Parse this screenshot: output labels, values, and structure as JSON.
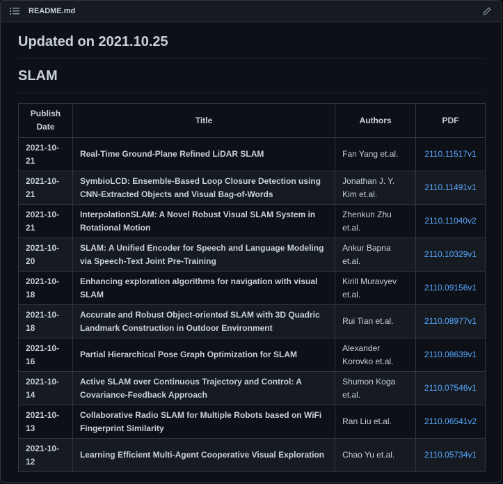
{
  "header": {
    "file_name": "README.md",
    "list_icon": "list-unordered-icon",
    "edit_icon": "pencil-icon"
  },
  "updated_heading": "Updated on 2021.10.25",
  "section_heading": "SLAM",
  "table": {
    "columns": [
      "Publish Date",
      "Title",
      "Authors",
      "PDF"
    ],
    "rows": [
      {
        "date": "2021-10-21",
        "title": "Real-Time Ground-Plane Refined LiDAR SLAM",
        "authors": "Fan Yang et.al.",
        "pdf": "2110.11517v1"
      },
      {
        "date": "2021-10-21",
        "title": "SymbioLCD: Ensemble-Based Loop Closure Detection using CNN-Extracted Objects and Visual Bag-of-Words",
        "authors": "Jonathan J. Y. Kim et.al.",
        "pdf": "2110.11491v1"
      },
      {
        "date": "2021-10-21",
        "title": "InterpolationSLAM: A Novel Robust Visual SLAM System in Rotational Motion",
        "authors": "Zhenkun Zhu et.al.",
        "pdf": "2110.11040v2"
      },
      {
        "date": "2021-10-20",
        "title": "SLAM: A Unified Encoder for Speech and Language Modeling via Speech-Text Joint Pre-Training",
        "authors": "Ankur Bapna et.al.",
        "pdf": "2110.10329v1"
      },
      {
        "date": "2021-10-18",
        "title": "Enhancing exploration algorithms for navigation with visual SLAM",
        "authors": "Kirill Muravyev et.al.",
        "pdf": "2110.09156v1"
      },
      {
        "date": "2021-10-18",
        "title": "Accurate and Robust Object-oriented SLAM with 3D Quadric Landmark Construction in Outdoor Environment",
        "authors": "Rui Tian et.al.",
        "pdf": "2110.08977v1"
      },
      {
        "date": "2021-10-16",
        "title": "Partial Hierarchical Pose Graph Optimization for SLAM",
        "authors": "Alexander Korovko et.al.",
        "pdf": "2110.08639v1"
      },
      {
        "date": "2021-10-14",
        "title": "Active SLAM over Continuous Trajectory and Control: A Covariance-Feedback Approach",
        "authors": "Shumon Koga et.al.",
        "pdf": "2110.07546v1"
      },
      {
        "date": "2021-10-13",
        "title": "Collaborative Radio SLAM for Multiple Robots based on WiFi Fingerprint Similarity",
        "authors": "Ran Liu et.al.",
        "pdf": "2110.06541v2"
      },
      {
        "date": "2021-10-12",
        "title": "Learning Efficient Multi-Agent Cooperative Visual Exploration",
        "authors": "Chao Yu et.al.",
        "pdf": "2110.05734v1"
      }
    ]
  },
  "colors": {
    "background": "#0d1117",
    "header_bg": "#161b22",
    "border": "#30363d",
    "text": "#c9d1d9",
    "link": "#58a6ff"
  }
}
